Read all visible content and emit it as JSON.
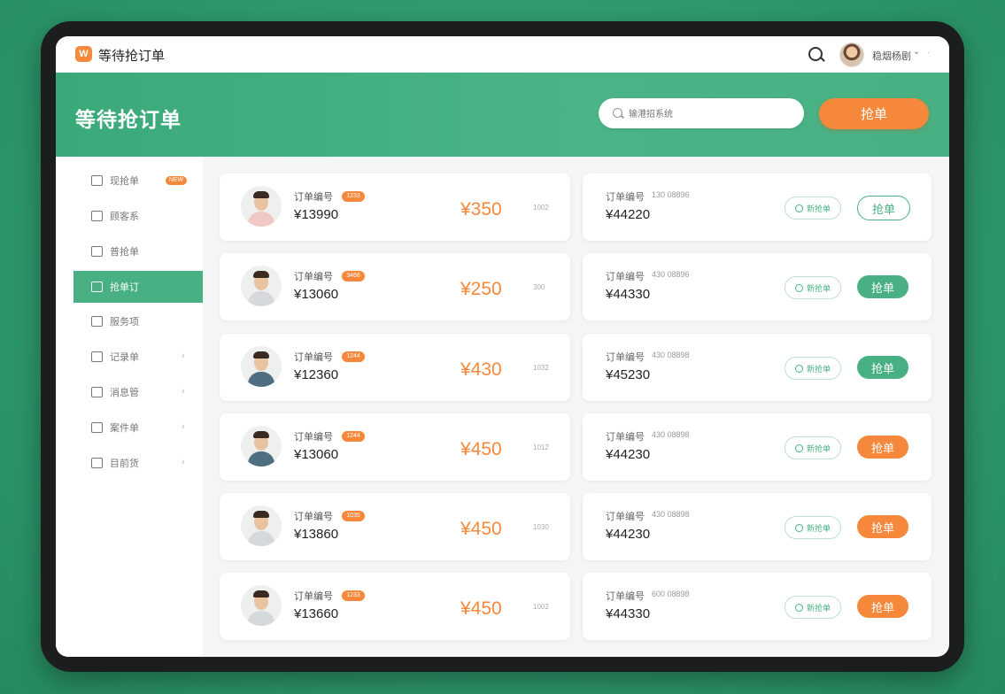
{
  "app": {
    "logo_glyph": "W",
    "title": "等待抢订单"
  },
  "topbar": {
    "user_name": "稳烟杨剧",
    "caret": "⌄",
    "more": "·"
  },
  "header": {
    "title": "等待抢订单",
    "search_placeholder": "输港招系统",
    "grab_label": "抢单"
  },
  "sidebar": {
    "items": [
      {
        "label": "现抢单",
        "badge": "NEW",
        "active": false,
        "arrow": ""
      },
      {
        "label": "顾客系",
        "badge": "",
        "active": false,
        "arrow": ""
      },
      {
        "label": "普抢单",
        "badge": "",
        "active": false,
        "arrow": ""
      },
      {
        "label": "抢单订",
        "badge": "",
        "active": true,
        "arrow": ""
      },
      {
        "label": "服务项",
        "badge": "",
        "active": false,
        "arrow": ""
      },
      {
        "label": "记录单",
        "badge": "",
        "active": false,
        "arrow": "›"
      },
      {
        "label": "消息管",
        "badge": "",
        "active": false,
        "arrow": "›"
      },
      {
        "label": "案件单",
        "badge": "",
        "active": false,
        "arrow": "›"
      },
      {
        "label": "目前货",
        "badge": "",
        "active": false,
        "arrow": "›"
      }
    ]
  },
  "orders": [
    {
      "label": "订单编号",
      "tag": "1233",
      "no": "¥13990",
      "price": "¥350",
      "meta": "1002",
      "avatar": "pink",
      "r_label": "订单编号",
      "r_meta": "130 08896",
      "r_amount": "¥44220",
      "status": "新抢单",
      "grab": "抢单",
      "grab_style": "outline"
    },
    {
      "label": "订单编号",
      "tag": "3466",
      "no": "¥13060",
      "price": "¥250",
      "meta": "300",
      "avatar": "light",
      "r_label": "订单编号",
      "r_meta": "430 08896",
      "r_amount": "¥44330",
      "status": "新抢单",
      "grab": "抢单",
      "grab_style": "green"
    },
    {
      "label": "订单编号",
      "tag": "1244",
      "no": "¥12360",
      "price": "¥430",
      "meta": "1032",
      "avatar": "dark",
      "r_label": "订单编号",
      "r_meta": "430 08898",
      "r_amount": "¥45230",
      "status": "新抢单",
      "grab": "抢单",
      "grab_style": "green"
    },
    {
      "label": "订单编号",
      "tag": "1244",
      "no": "¥13060",
      "price": "¥450",
      "meta": "1012",
      "avatar": "dark",
      "r_label": "订单编号",
      "r_meta": "430 08898",
      "r_amount": "¥44230",
      "status": "新抢单",
      "grab": "抢单",
      "grab_style": "orange"
    },
    {
      "label": "订单编号",
      "tag": "1035",
      "no": "¥13860",
      "price": "¥450",
      "meta": "1030",
      "avatar": "light",
      "r_label": "订单编号",
      "r_meta": "430 08898",
      "r_amount": "¥44230",
      "status": "新抢单",
      "grab": "抢单",
      "grab_style": "orange"
    },
    {
      "label": "订单编号",
      "tag": "1233",
      "no": "¥13660",
      "price": "¥450",
      "meta": "1002",
      "avatar": "light",
      "r_label": "订单编号",
      "r_meta": "600 08898",
      "r_amount": "¥44330",
      "status": "新抢单",
      "grab": "抢单",
      "grab_style": "orange"
    }
  ],
  "colors": {
    "accent_green": "#49b083",
    "accent_orange": "#f5883a",
    "outer_bg": "#2f9a6d"
  }
}
